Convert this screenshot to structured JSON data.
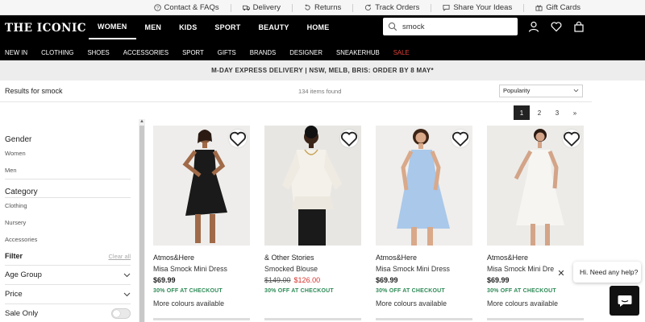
{
  "utility_links": [
    {
      "label": "Contact & FAQs",
      "icon": "question-circle-icon"
    },
    {
      "label": "Delivery",
      "icon": "truck-icon"
    },
    {
      "label": "Returns",
      "icon": "return-icon"
    },
    {
      "label": "Track Orders",
      "icon": "refresh-icon"
    },
    {
      "label": "Share Your Ideas",
      "icon": "chat-icon"
    },
    {
      "label": "Gift Cards",
      "icon": "gift-icon"
    }
  ],
  "brand": {
    "logo_text": "THE ICONIC"
  },
  "categories": [
    "WOMEN",
    "MEN",
    "KIDS",
    "SPORT",
    "BEAUTY",
    "HOME"
  ],
  "active_category": "WOMEN",
  "search": {
    "value": "smock",
    "placeholder": "Search"
  },
  "subnav": [
    "NEW IN",
    "CLOTHING",
    "SHOES",
    "ACCESSORIES",
    "SPORT",
    "GIFTS",
    "BRANDS",
    "DESIGNER",
    "SNEAKERHUB",
    "SALE"
  ],
  "promo_banner": "M-DAY EXPRESS DELIVERY | NSW, MELB, BRIS: ORDER BY 8 MAY*",
  "results": {
    "label": "Results for smock",
    "count": "134 items found",
    "sort_value": "Popularity"
  },
  "pagination": {
    "pages": [
      "1",
      "2",
      "3"
    ],
    "current": "1",
    "next": "»"
  },
  "sidebar": {
    "gender_title": "Gender",
    "gender_items": [
      "Women",
      "Men"
    ],
    "category_title": "Category",
    "category_items": [
      "Clothing",
      "Nursery",
      "Accessories"
    ],
    "filter_title": "Filter",
    "clear_all": "Clear all",
    "age_group": "Age Group",
    "price": "Price",
    "sale_only": "Sale Only",
    "sale_only_on": false
  },
  "products": [
    {
      "brand": "Atmos&Here",
      "name": "Misa Smock Mini Dress",
      "price": "$69.99",
      "old_price": "",
      "sale_price": "",
      "promo": "30% OFF AT CHECKOUT",
      "colours": "More colours available",
      "dress_color": "#1a1a1a"
    },
    {
      "brand": "& Other Stories",
      "name": "Smocked Blouse",
      "price": "",
      "old_price": "$149.00",
      "sale_price": "$126.00",
      "promo": "30% OFF AT CHECKOUT",
      "colours": "",
      "dress_color": "#f2efe9"
    },
    {
      "brand": "Atmos&Here",
      "name": "Misa Smock Mini Dress",
      "price": "$69.99",
      "old_price": "",
      "sale_price": "",
      "promo": "30% OFF AT CHECKOUT",
      "colours": "More colours available",
      "dress_color": "#a9c8ea"
    },
    {
      "brand": "Atmos&Here",
      "name": "Misa Smock Mini Dre",
      "price": "$69.99",
      "old_price": "",
      "sale_price": "",
      "promo": "30% OFF AT CHECKOUT",
      "colours": "More colours available",
      "dress_color": "#f4f3ef"
    }
  ],
  "chat": {
    "greeting": "Hi. Need any help?",
    "close": "✕"
  },
  "colors": {
    "header_bg": "#000000",
    "sale_red": "#e0413a",
    "promo_green": "#2e8b57"
  }
}
